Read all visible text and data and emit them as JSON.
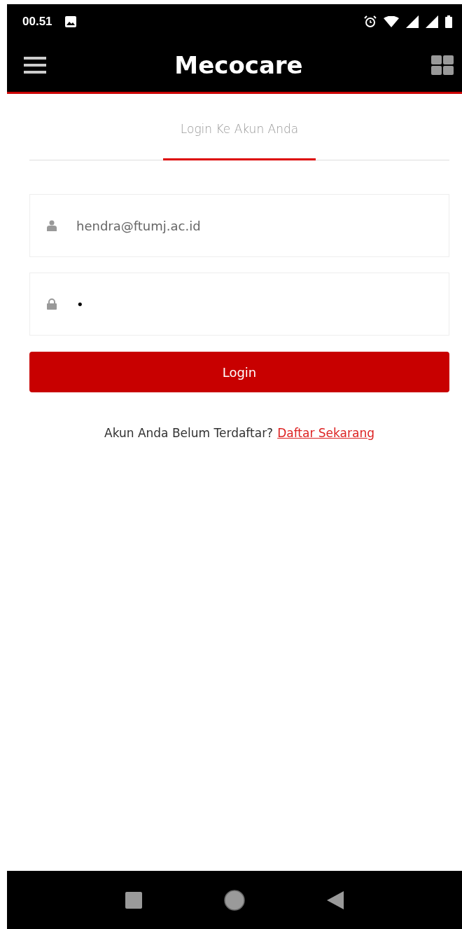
{
  "status_bar": {
    "time": "00.51"
  },
  "app_bar": {
    "title": "Mecocare"
  },
  "tabs": [
    {
      "label": "Login Ke Akun Anda",
      "selected": true
    }
  ],
  "fields": [
    {
      "kind": "email",
      "value": "hendra@ftumj.ac.id"
    },
    {
      "kind": "password",
      "value": "•"
    }
  ],
  "login_button": "Login",
  "register_prompt": {
    "text": "Akun Anda Belum Terdaftar?",
    "link": "Daftar Sekarang"
  }
}
